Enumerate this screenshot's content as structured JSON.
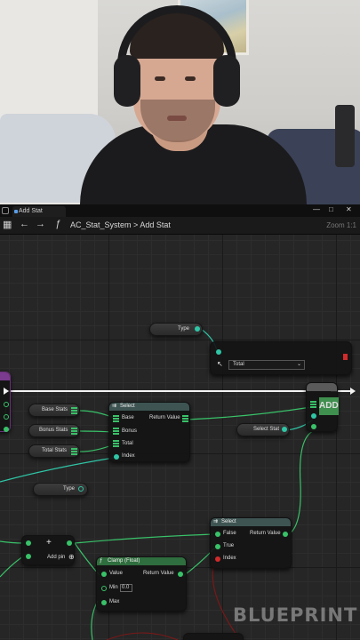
{
  "window": {
    "tab_title": "Add Stat",
    "minimize": "—",
    "maximize": "□",
    "close": "✕"
  },
  "toolbar": {
    "breadcrumb_root": "AC_Stat_System",
    "breadcrumb_separator": ">",
    "breadcrumb_leaf": "Add Stat",
    "zoom": "Zoom 1:1",
    "function_symbol": "ƒ"
  },
  "nodes": {
    "type_getter_top": "Type",
    "type_getter_mid": "Type",
    "total_dropdown": "Total",
    "base_stats": "Base Stats",
    "bonus_stats": "Bonus Stats",
    "total_stats": "Total Stats",
    "select_stat": "Select Stat",
    "add_node": "ADD",
    "select1": {
      "title": "Select",
      "base": "Base",
      "bonus": "Bonus",
      "total": "Total",
      "index": "Index",
      "return_value": "Return Value"
    },
    "select2": {
      "title": "Select",
      "false": "False",
      "true": "True",
      "index": "Index",
      "return_value": "Return Value"
    },
    "add_pin": "Add pin",
    "clamp": {
      "title": "Clamp (Float)",
      "value": "Value",
      "min": "Min",
      "min_value": "0.0",
      "max": "Max",
      "return_value": "Return Value"
    }
  },
  "watermark": "BLUEPRINT",
  "colors": {
    "float_pin": "#39c269",
    "enum_pin": "#2fc6a6",
    "bool_pin": "#d12a2a",
    "select_header": "#3e5452",
    "clamp_header": "#2f6e3e"
  }
}
